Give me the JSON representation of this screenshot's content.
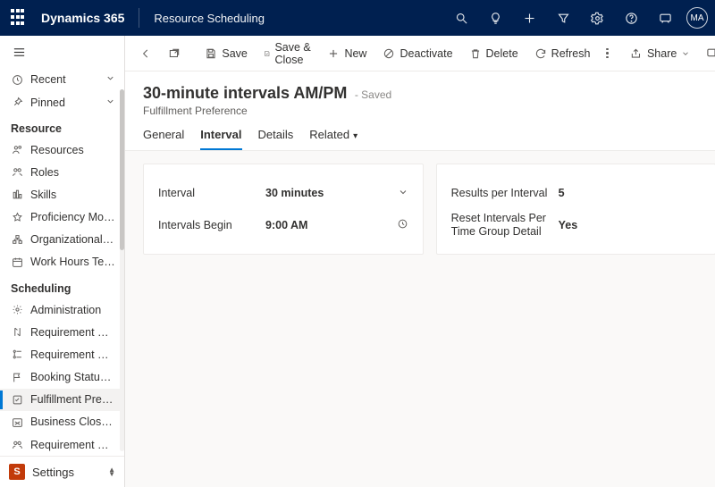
{
  "topbar": {
    "brand": "Dynamics 365",
    "module": "Resource Scheduling",
    "avatar_initials": "MA"
  },
  "sidebar": {
    "recent": "Recent",
    "pinned": "Pinned",
    "sections": {
      "resource": "Resource",
      "scheduling": "Scheduling"
    },
    "resource_items": [
      "Resources",
      "Roles",
      "Skills",
      "Proficiency Models",
      "Organizational Un…",
      "Work Hours Temp…"
    ],
    "scheduling_items": [
      "Administration",
      "Requirement Prior…",
      "Requirement Stat…",
      "Booking Statuses",
      "Fulfillment Prefer…",
      "Business Closures",
      "Requirement Gro…"
    ],
    "settings_label": "Settings",
    "settings_badge": "S"
  },
  "cmdbar": {
    "save": "Save",
    "save_close": "Save & Close",
    "new": "New",
    "deactivate": "Deactivate",
    "delete": "Delete",
    "refresh": "Refresh",
    "share": "Share"
  },
  "header": {
    "title": "30-minute intervals AM/PM",
    "state": "- Saved",
    "subtitle": "Fulfillment Preference"
  },
  "tabs": {
    "general": "General",
    "interval": "Interval",
    "details": "Details",
    "related": "Related"
  },
  "form": {
    "left": {
      "interval_label": "Interval",
      "interval_value": "30 minutes",
      "begin_label": "Intervals Begin",
      "begin_value": "9:00 AM"
    },
    "right": {
      "rpi_label": "Results per Interval",
      "rpi_value": "5",
      "reset_label": "Reset Intervals Per Time Group Detail",
      "reset_value": "Yes"
    }
  }
}
